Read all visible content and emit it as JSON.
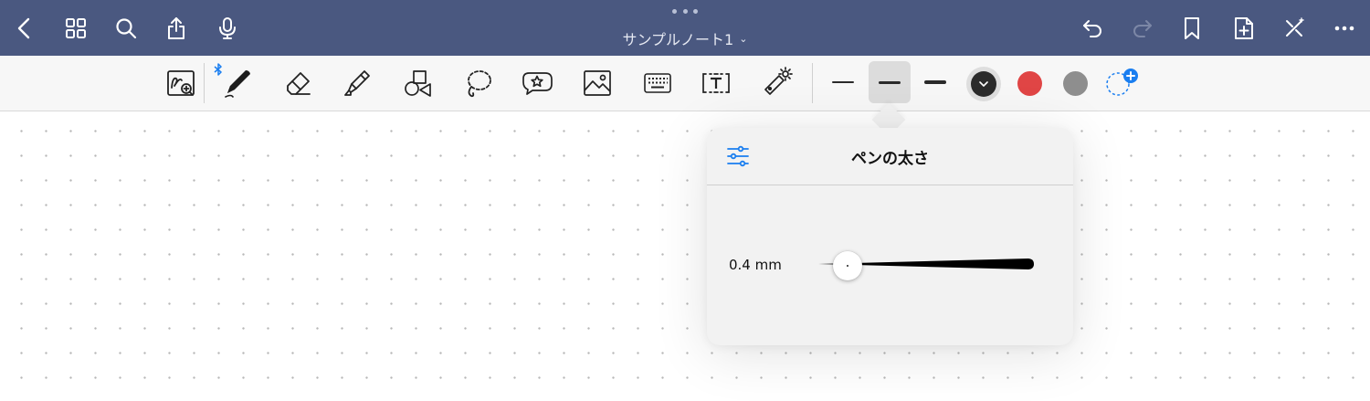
{
  "header": {
    "title": "サンプルノート1",
    "icons": [
      "back-icon",
      "grid-icon",
      "search-icon",
      "share-icon",
      "microphone-icon",
      "undo-icon",
      "redo-icon",
      "bookmark-icon",
      "add-page-icon",
      "close-sparkle-icon",
      "more-icon"
    ]
  },
  "toolbar": {
    "tools": [
      "zoom-pen-icon",
      "pen-icon",
      "eraser-icon",
      "highlighter-icon",
      "shapes-icon",
      "lasso-icon",
      "sticker-icon",
      "image-icon",
      "keyboard-icon",
      "textbox-icon",
      "laser-pointer-icon"
    ],
    "stroke_options": [
      "thin",
      "medium",
      "thick"
    ],
    "selected_stroke": "medium",
    "colors": [
      "#2b2b2b",
      "#e04545",
      "#8e8e8e"
    ],
    "selected_color": "#2b2b2b",
    "accent": "#1a7ef0"
  },
  "popover": {
    "title": "ペンの太さ",
    "size_label": "0.4 mm",
    "slider_value": 0.05
  }
}
